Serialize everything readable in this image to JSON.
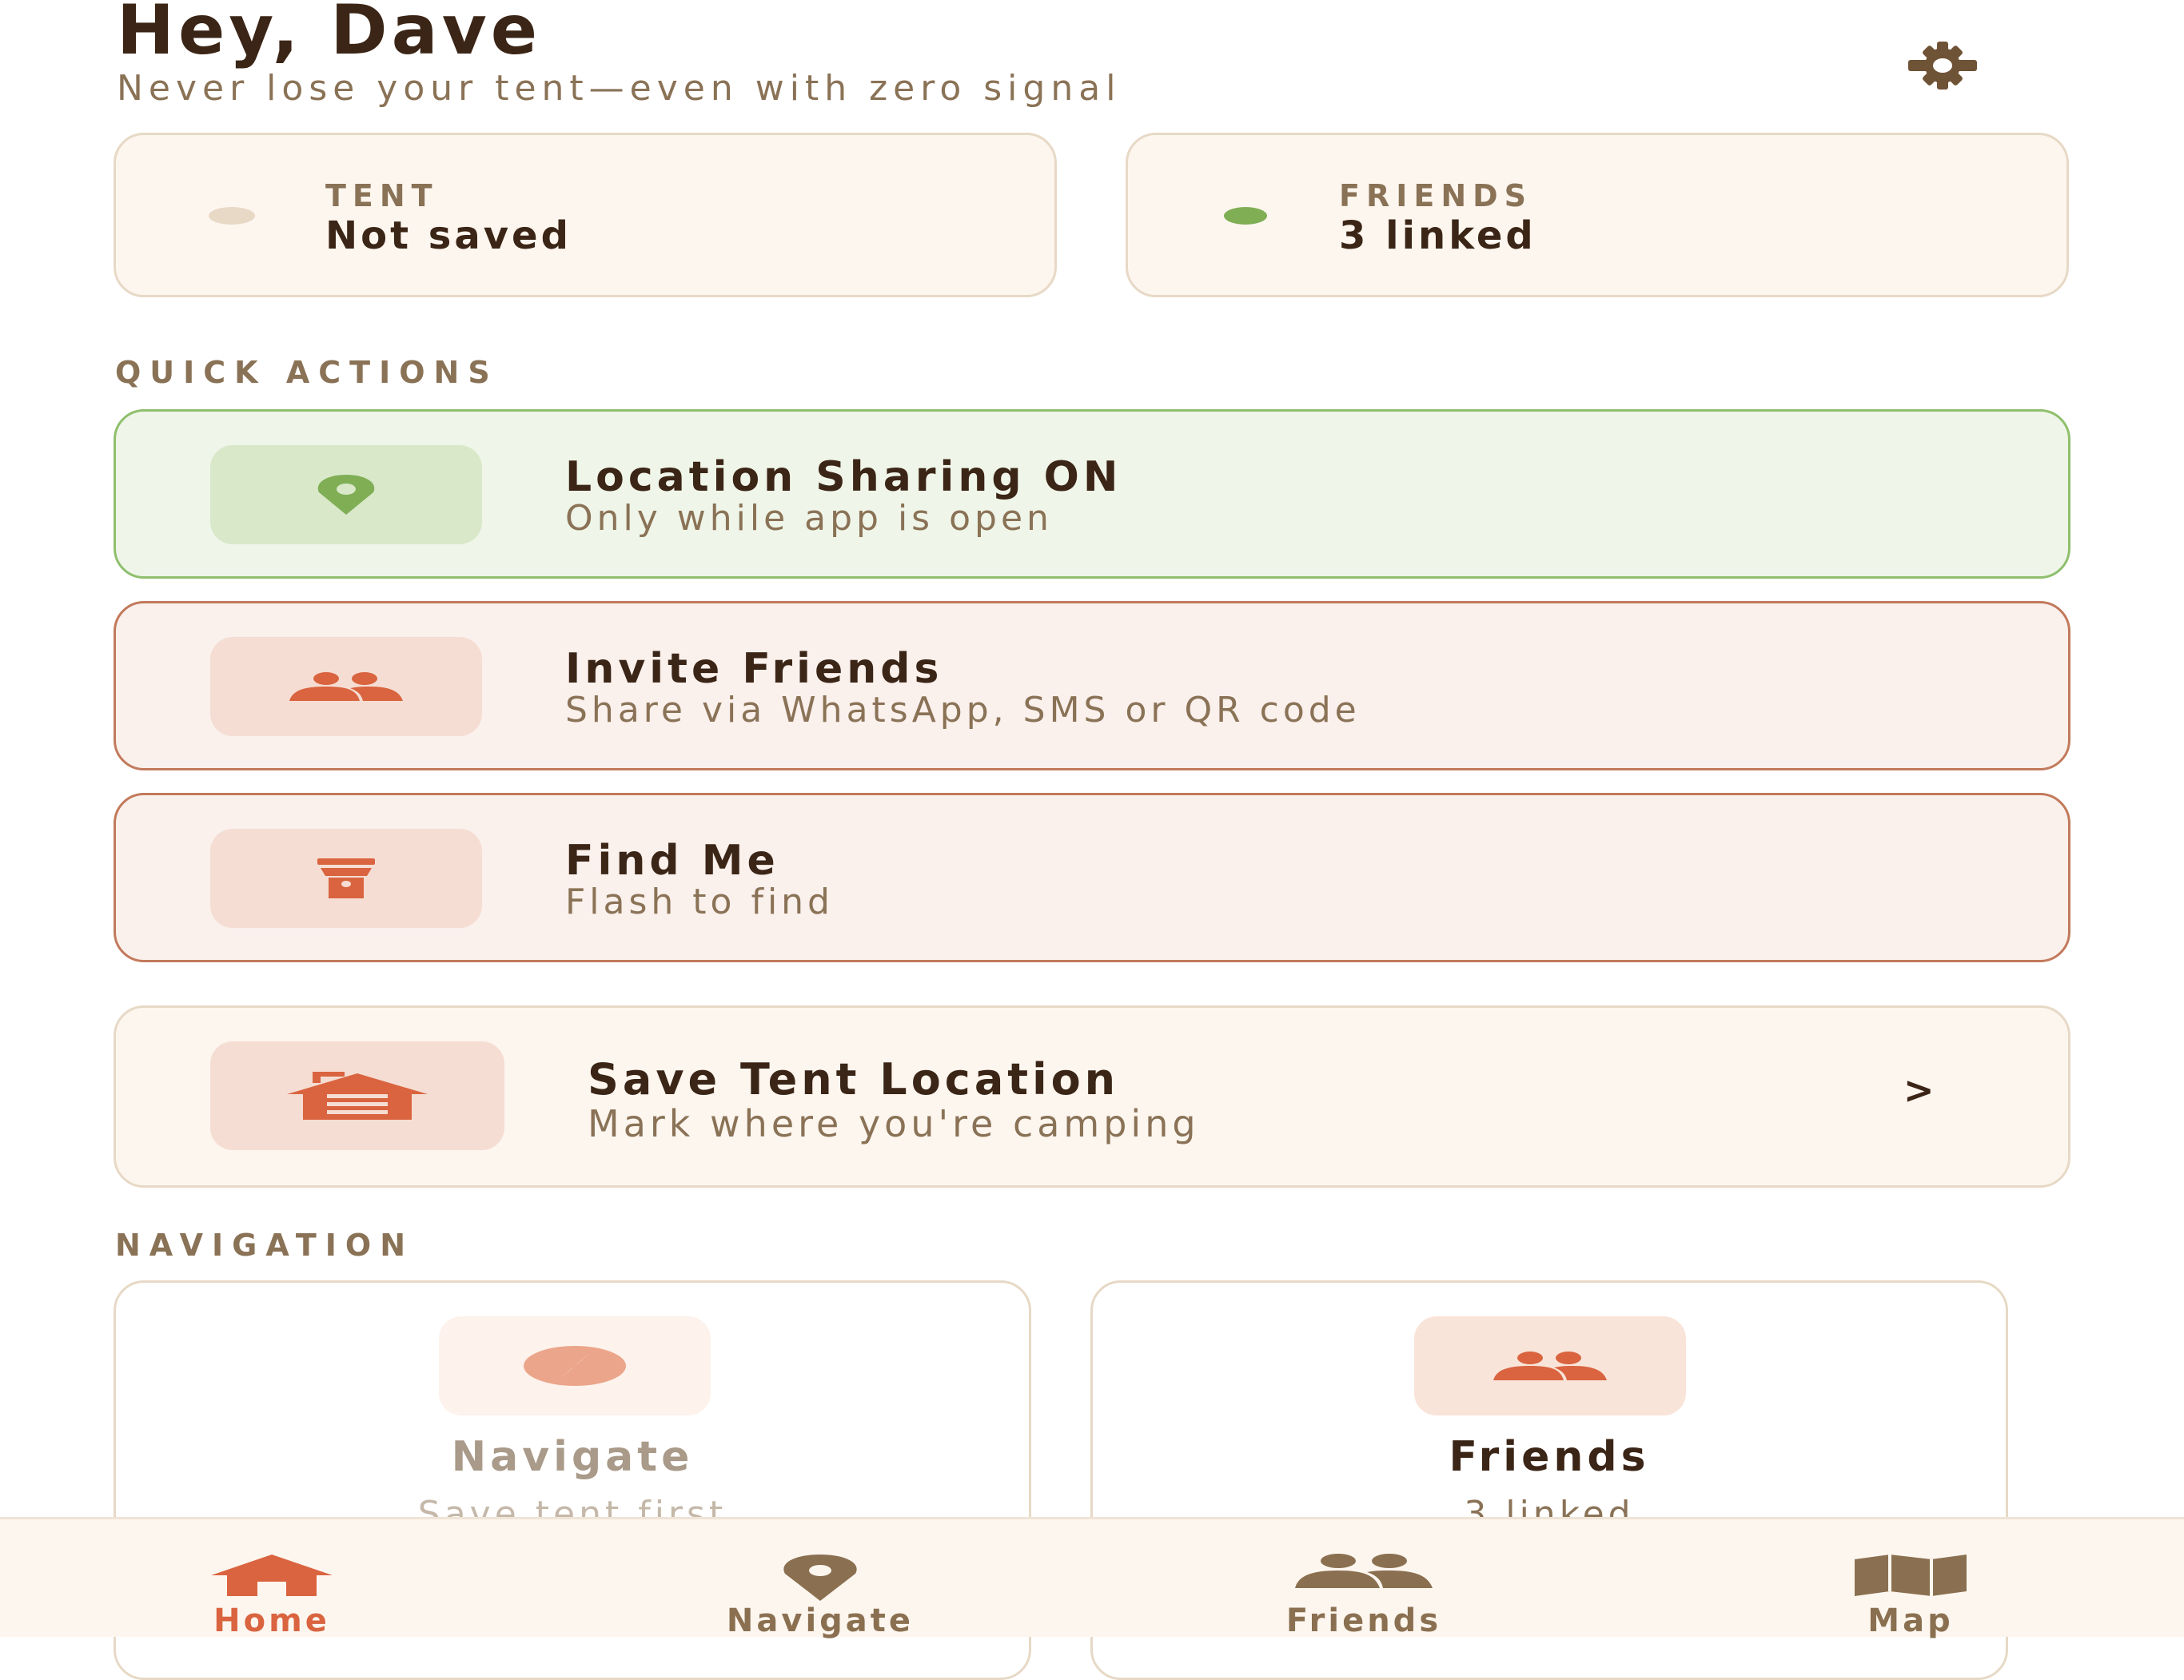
{
  "header": {
    "greeting": "Hey, Dave",
    "subtitle": "Never lose your tent—even with zero signal",
    "settings_icon": "gear-icon"
  },
  "status": {
    "tent": {
      "label": "TENT",
      "value": "Not saved",
      "dot_color": "#e8d8c6"
    },
    "friends": {
      "label": "FRIENDS",
      "value": "3 linked",
      "dot_color": "#7fae55"
    }
  },
  "quick_actions": {
    "title": "QUICK ACTIONS",
    "location": {
      "title": "Location Sharing ON",
      "subtitle": "Only while app is open",
      "icon": "location-pin-icon"
    },
    "invite": {
      "title": "Invite Friends",
      "subtitle": "Share via WhatsApp, SMS or QR code",
      "icon": "people-icon"
    },
    "find_me": {
      "title": "Find Me",
      "subtitle": "Flash to find",
      "icon": "flashlight-icon"
    },
    "save_tent": {
      "title": "Save Tent Location",
      "subtitle": "Mark where you're camping",
      "chevron": ">",
      "icon": "tent-icon"
    }
  },
  "navigation": {
    "title": "NAVIGATION",
    "navigate": {
      "title": "Navigate",
      "subtitle": "Save tent first",
      "icon": "compass-icon"
    },
    "friends": {
      "title": "Friends",
      "subtitle": "3 linked",
      "icon": "people-icon"
    }
  },
  "tabs": [
    {
      "label": "Home",
      "icon": "home-icon"
    },
    {
      "label": "Navigate",
      "icon": "location-pin-icon"
    },
    {
      "label": "Friends",
      "icon": "people-icon"
    },
    {
      "label": "Map",
      "icon": "map-icon"
    }
  ],
  "colors": {
    "brown_dark": "#3b2516",
    "brown_muted": "#8a7256",
    "accent_orange": "#d9643f",
    "green": "#7fae55",
    "tab_icon_brown": "#8a7050"
  }
}
